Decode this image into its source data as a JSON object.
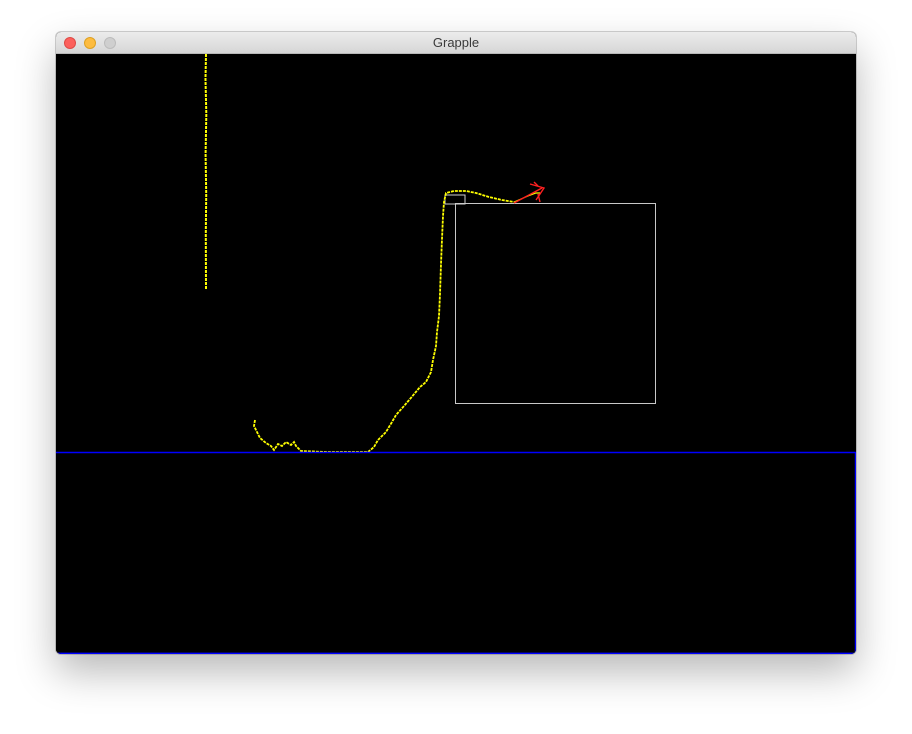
{
  "window": {
    "title": "Grapple",
    "controls": [
      "close-button",
      "minimize-button",
      "zoom-button"
    ]
  },
  "scene": {
    "background_color": "#000000",
    "ground_color": "#0000ff",
    "rope_color": "#ffff00",
    "box_outline_color": "#ffffff",
    "hook_color": "#ff0000"
  }
}
